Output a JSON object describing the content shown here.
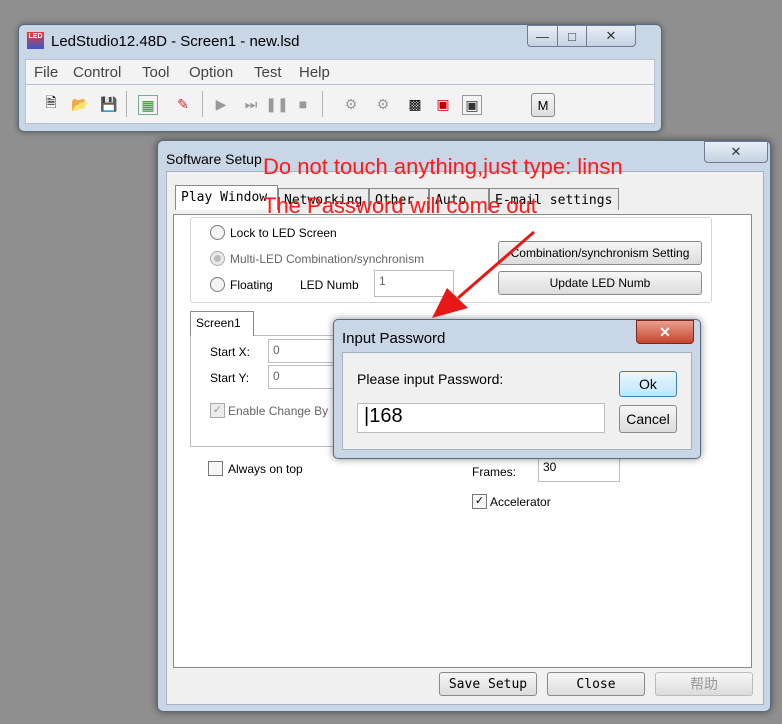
{
  "app": {
    "title": "LedStudio12.48D - Screen1 - new.lsd",
    "logo_text": "LED",
    "menu": [
      "File",
      "Control",
      "Tool",
      "Option",
      "Test",
      "Help"
    ],
    "toolbar_m_label": "M"
  },
  "setup": {
    "title": "Software Setup",
    "tabs": [
      "Play Window",
      "Networking",
      "Other",
      "Auto",
      "E-mail settings"
    ],
    "lock_label": "Lock to LED Screen",
    "multi_label": "Multi-LED Combination/synchronism",
    "floating_label": "Floating",
    "led_numb_label": "LED Numb",
    "led_numb_value": "1",
    "combination_button": "Combination/synchronism Setting",
    "update_button": "Update LED Numb",
    "screen_tab": "Screen1",
    "start_x_label": "Start X:",
    "start_x_value": "0",
    "start_y_label": "Start Y:",
    "start_y_value": "0",
    "enable_change_label": "Enable Change By",
    "always_on_top_label": "Always on top",
    "frames_label": "Frames:",
    "frames_value": "30",
    "accelerator_label": "Accelerator",
    "save_button": "Save Setup",
    "close_button": "Close",
    "help_button": "帮助"
  },
  "password": {
    "title": "Input Password",
    "prompt": "Please input Password:",
    "value": "168",
    "ok_button": "Ok",
    "cancel_button": "Cancel"
  },
  "annotation": {
    "line1": "Do not touch  anything,just type: linsn",
    "line2": "The Password will come out",
    "color": "#ff1a1a"
  }
}
